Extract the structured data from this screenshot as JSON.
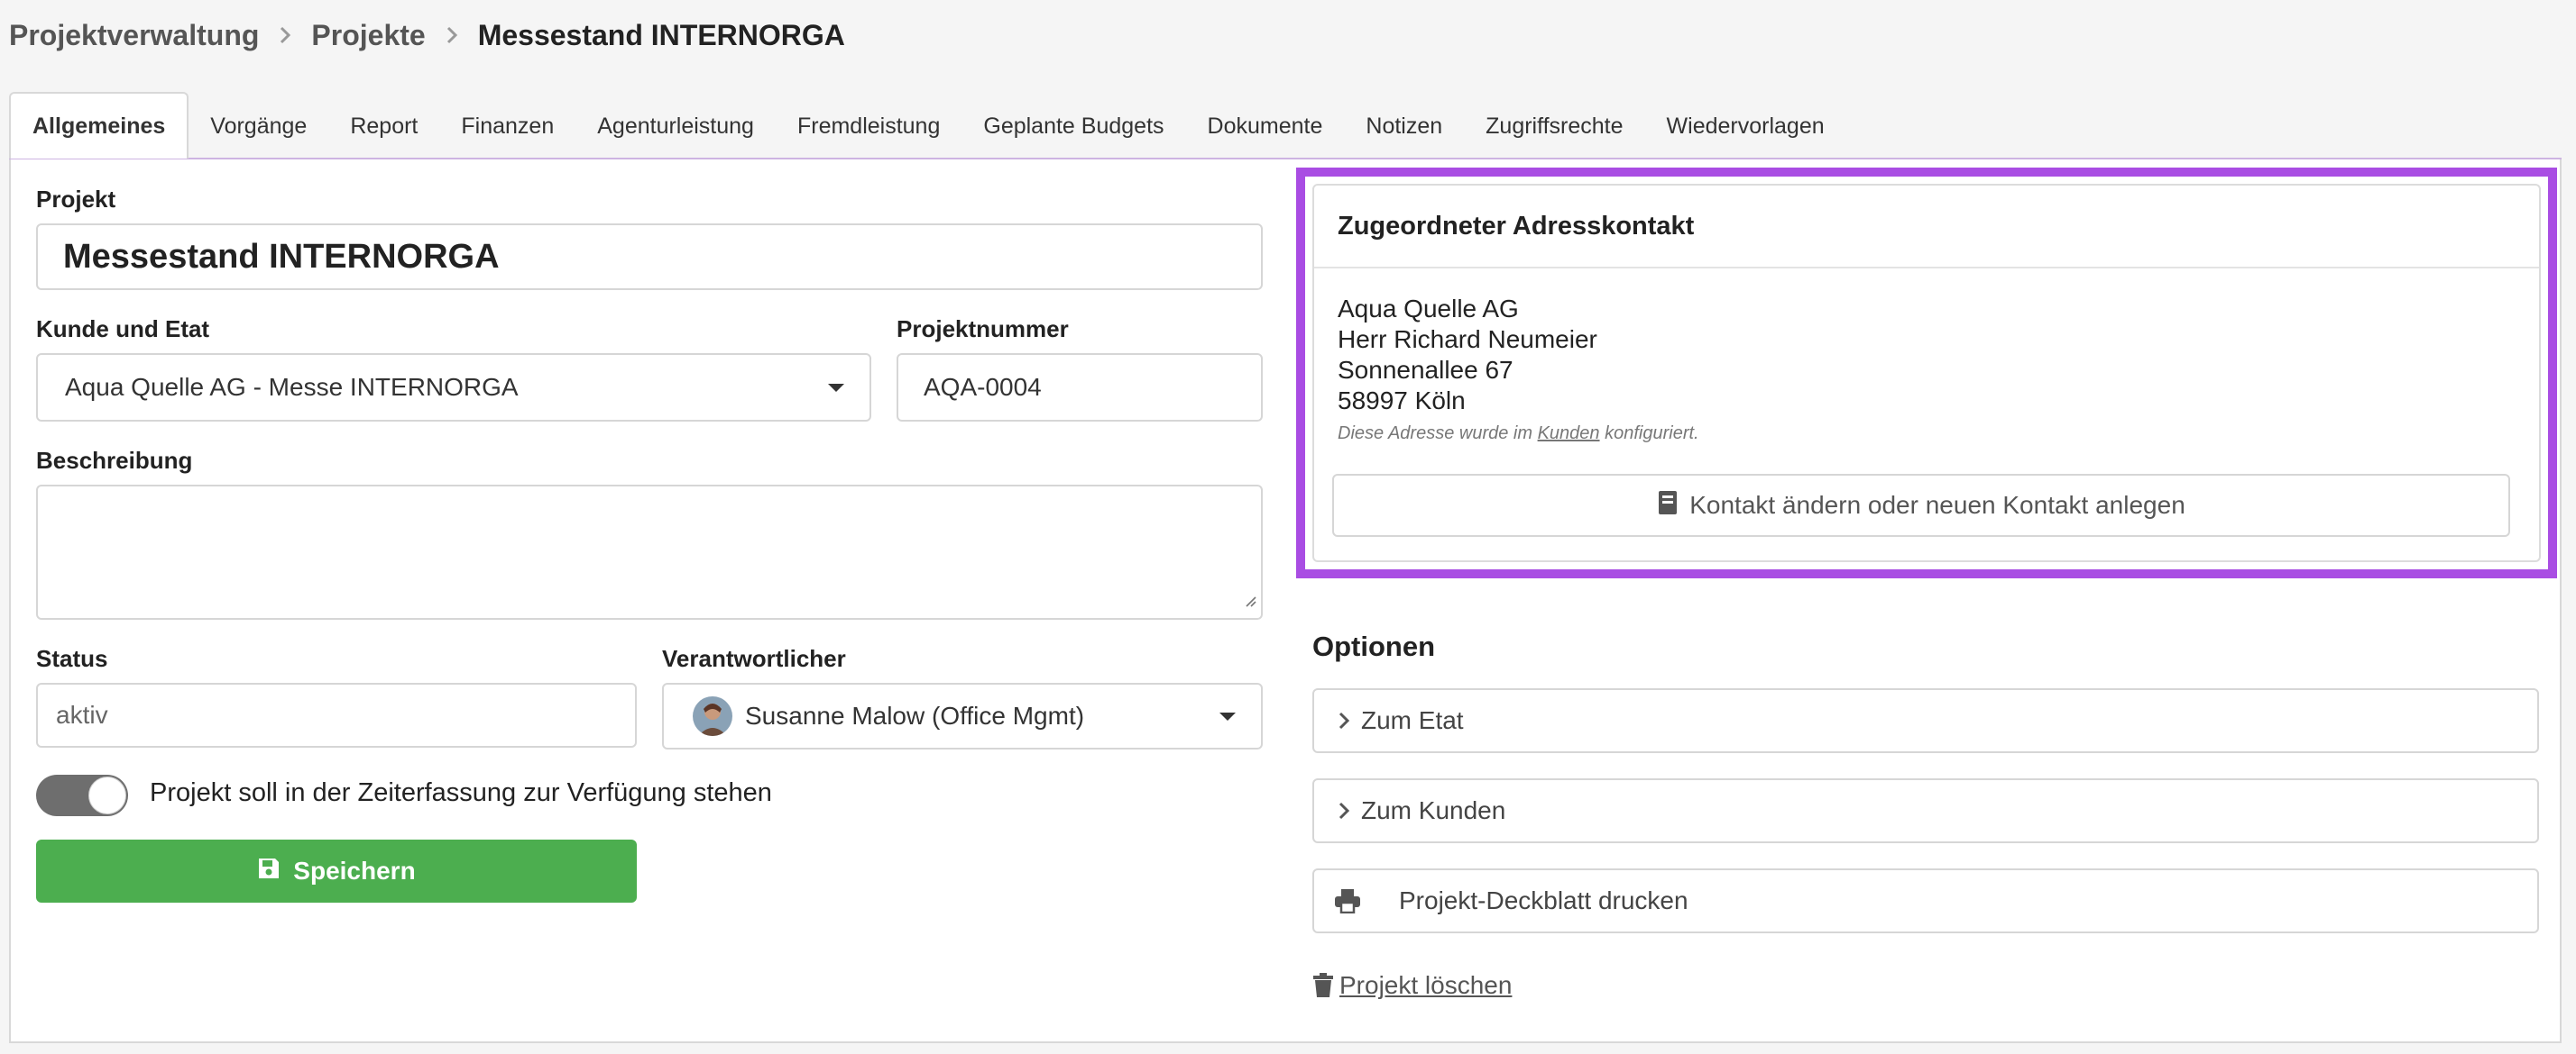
{
  "breadcrumb": {
    "items": [
      "Projektverwaltung",
      "Projekte"
    ],
    "current": "Messestand INTERNORGA"
  },
  "tabs": [
    {
      "label": "Allgemeines",
      "active": true
    },
    {
      "label": "Vorgänge"
    },
    {
      "label": "Report"
    },
    {
      "label": "Finanzen"
    },
    {
      "label": "Agenturleistung"
    },
    {
      "label": "Fremdleistung"
    },
    {
      "label": "Geplante Budgets"
    },
    {
      "label": "Dokumente"
    },
    {
      "label": "Notizen"
    },
    {
      "label": "Zugriffsrechte"
    },
    {
      "label": "Wiedervorlagen"
    }
  ],
  "form": {
    "project_label": "Projekt",
    "project_value": "Messestand INTERNORGA",
    "customer_label": "Kunde und Etat",
    "customer_value": "Aqua Quelle AG - Messe INTERNORGA",
    "number_label": "Projektnummer",
    "number_value": "AQA-0004",
    "description_label": "Beschreibung",
    "description_value": "",
    "status_label": "Status",
    "status_value": "aktiv",
    "responsible_label": "Verantwortlicher",
    "responsible_value": "Susanne Malow (Office Mgmt)",
    "timetracking_label": "Projekt soll in der Zeiterfassung zur Verfügung stehen",
    "timetracking_enabled": true,
    "save_label": "Speichern"
  },
  "contact": {
    "header": "Zugeordneter Adresskontakt",
    "company": "Aqua Quelle AG",
    "person": "Herr Richard Neumeier",
    "street": "Sonnenallee 67",
    "city": "58997 Köln",
    "note_prefix": "Diese Adresse wurde im",
    "note_link": "Kunden",
    "note_suffix": "konfiguriert.",
    "button_label": "Kontakt ändern oder neuen Kontakt anlegen"
  },
  "options": {
    "title": "Optionen",
    "to_budget": "Zum Etat",
    "to_customer": "Zum Kunden",
    "print_cover": "Projekt-Deckblatt drucken",
    "delete_project": "Projekt löschen"
  },
  "colors": {
    "accent_highlight": "#a94de3",
    "save_button": "#4cae4f",
    "toggle_on": "#6e6e6e"
  }
}
